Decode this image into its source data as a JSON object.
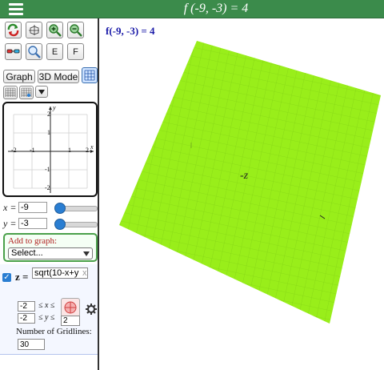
{
  "header": {
    "title": "f (-9, -3) = 4"
  },
  "toolbar": {
    "row1": [
      "rotate-icon",
      "cube-axes-icon",
      "zoom-in-icon",
      "zoom-out-icon"
    ],
    "row2": [
      "glasses-3d-icon",
      "magnifier-icon"
    ],
    "e_label": "E",
    "f_label": "F",
    "graph_label": "Graph",
    "mode_label": "3D Mode"
  },
  "mini_graph": {
    "x_ticks": [
      "-2",
      "-1",
      "1",
      "2"
    ],
    "y_ticks": [
      "2",
      "1",
      "-1",
      "-2"
    ],
    "x_axis": "x",
    "y_axis": "y"
  },
  "variables": {
    "x_label": "x =",
    "x_value": "-9",
    "y_label": "y =",
    "y_value": "-3",
    "x_slider": 0.0,
    "y_slider": 0.0
  },
  "add_to_graph": {
    "label": "Add to graph:",
    "selected": "Select..."
  },
  "function": {
    "checked": true,
    "lhs": "z =",
    "formula": "sqrt(10-x+y",
    "close": "x",
    "x_min": "-2",
    "x_rel": "≤ x ≤",
    "y_min": "-2",
    "y_rel": "≤ y ≤",
    "y_max": "2",
    "gridlines_label": "Number of Gridlines:",
    "gridlines_value": "30"
  },
  "graph": {
    "value_text": "f(-9, -3) = 4",
    "z_label": "-z",
    "surface_color": "#99ee1a"
  }
}
